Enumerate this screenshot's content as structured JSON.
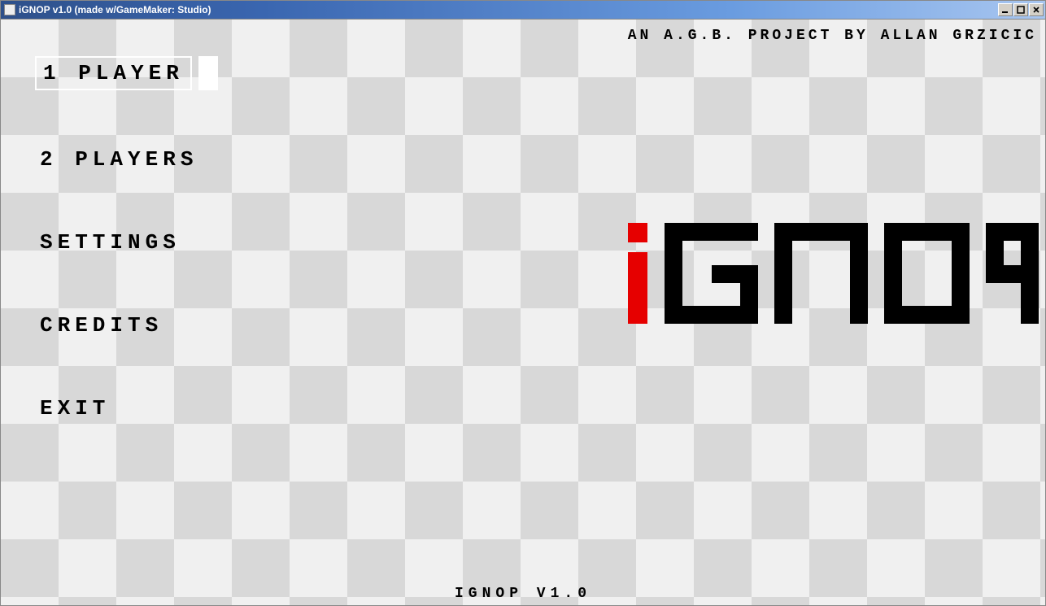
{
  "window": {
    "title": "iGNOP v1.0 (made w/GameMaker: Studio)"
  },
  "credit": "AN  A.G.B.  PROJECT  BY  ALLAN  GRZICIC",
  "menu": {
    "items": [
      {
        "label": "1  PLAYER",
        "selected": true
      },
      {
        "label": "2  PLAYERS",
        "selected": false
      },
      {
        "label": "SETTINGS",
        "selected": false
      },
      {
        "label": "CREDITS",
        "selected": false
      },
      {
        "label": "EXIT",
        "selected": false
      }
    ]
  },
  "footer": "IGNOP  V1.0",
  "logo_text": "iGNOP",
  "colors": {
    "accent": "#e60000",
    "logo": "#000000",
    "board_light": "#f0f0f0",
    "board_dark": "#d8d8d8"
  }
}
